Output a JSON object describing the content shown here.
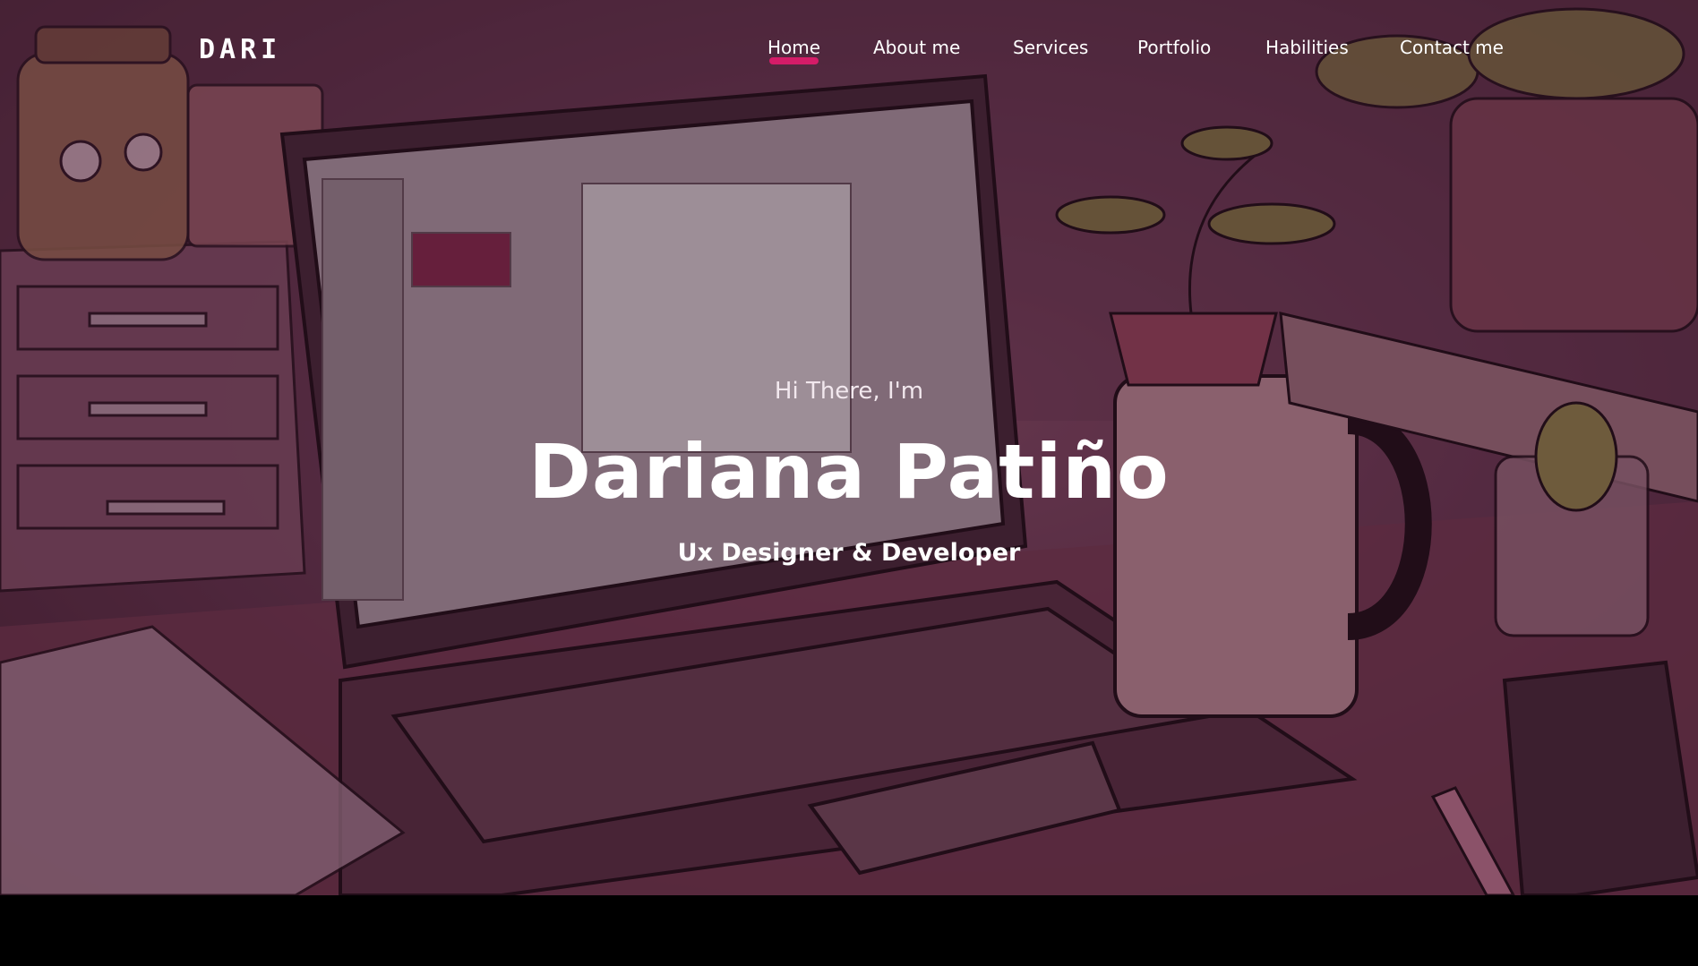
{
  "header": {
    "logo_text": "DARI",
    "nav": [
      {
        "label": "Home",
        "active": true
      },
      {
        "label": "About me",
        "active": false
      },
      {
        "label": "Services",
        "active": false
      },
      {
        "label": "Portfolio",
        "active": false
      },
      {
        "label": "Habilities",
        "active": false
      },
      {
        "label": "Contact me",
        "active": false
      }
    ]
  },
  "hero": {
    "greeting": "Hi There, I'm",
    "name": "Dariana Patiño",
    "role": "Ux Designer & Developer",
    "background_illustration": "desk-with-laptop-mug-plants-illustration"
  },
  "colors": {
    "accent": "#e21b6d",
    "hero_tint": "#6f3c57",
    "text": "#ffffff"
  }
}
